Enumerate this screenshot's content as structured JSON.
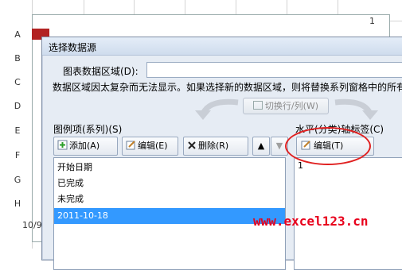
{
  "spreadsheet": {
    "row_headers": [
      "A",
      "B",
      "C",
      "D",
      "E",
      "F",
      "G",
      "H"
    ],
    "chart_corner_value": "1",
    "chart_x_label": "10/9"
  },
  "dialog": {
    "title": "选择数据源",
    "range_label": "图表数据区域(D):",
    "range_value": "",
    "warning": "数据区域因太复杂而无法显示。如果选择新的数据区域，则将替换系列窗格中的所有",
    "switch_label": "切换行/列(W)"
  },
  "series_panel": {
    "label": "图例项(系列)(S)",
    "add_label": "添加(A)",
    "edit_label": "编辑(E)",
    "delete_label": "删除(R)",
    "up_symbol": "▲",
    "down_symbol": "▼",
    "items": [
      "开始日期",
      "已完成",
      "未完成",
      "2011-10-18"
    ],
    "selected_index": 3
  },
  "axis_panel": {
    "label": "水平(分类)轴标签(C)",
    "edit_label": "编辑(T)",
    "items": [
      "1"
    ]
  },
  "watermark": "www.excel123.cn",
  "colors": {
    "selection": "#3399ff",
    "annotation": "#e02020",
    "watermark": "#e8001c",
    "chart_bar": "#b22222"
  }
}
